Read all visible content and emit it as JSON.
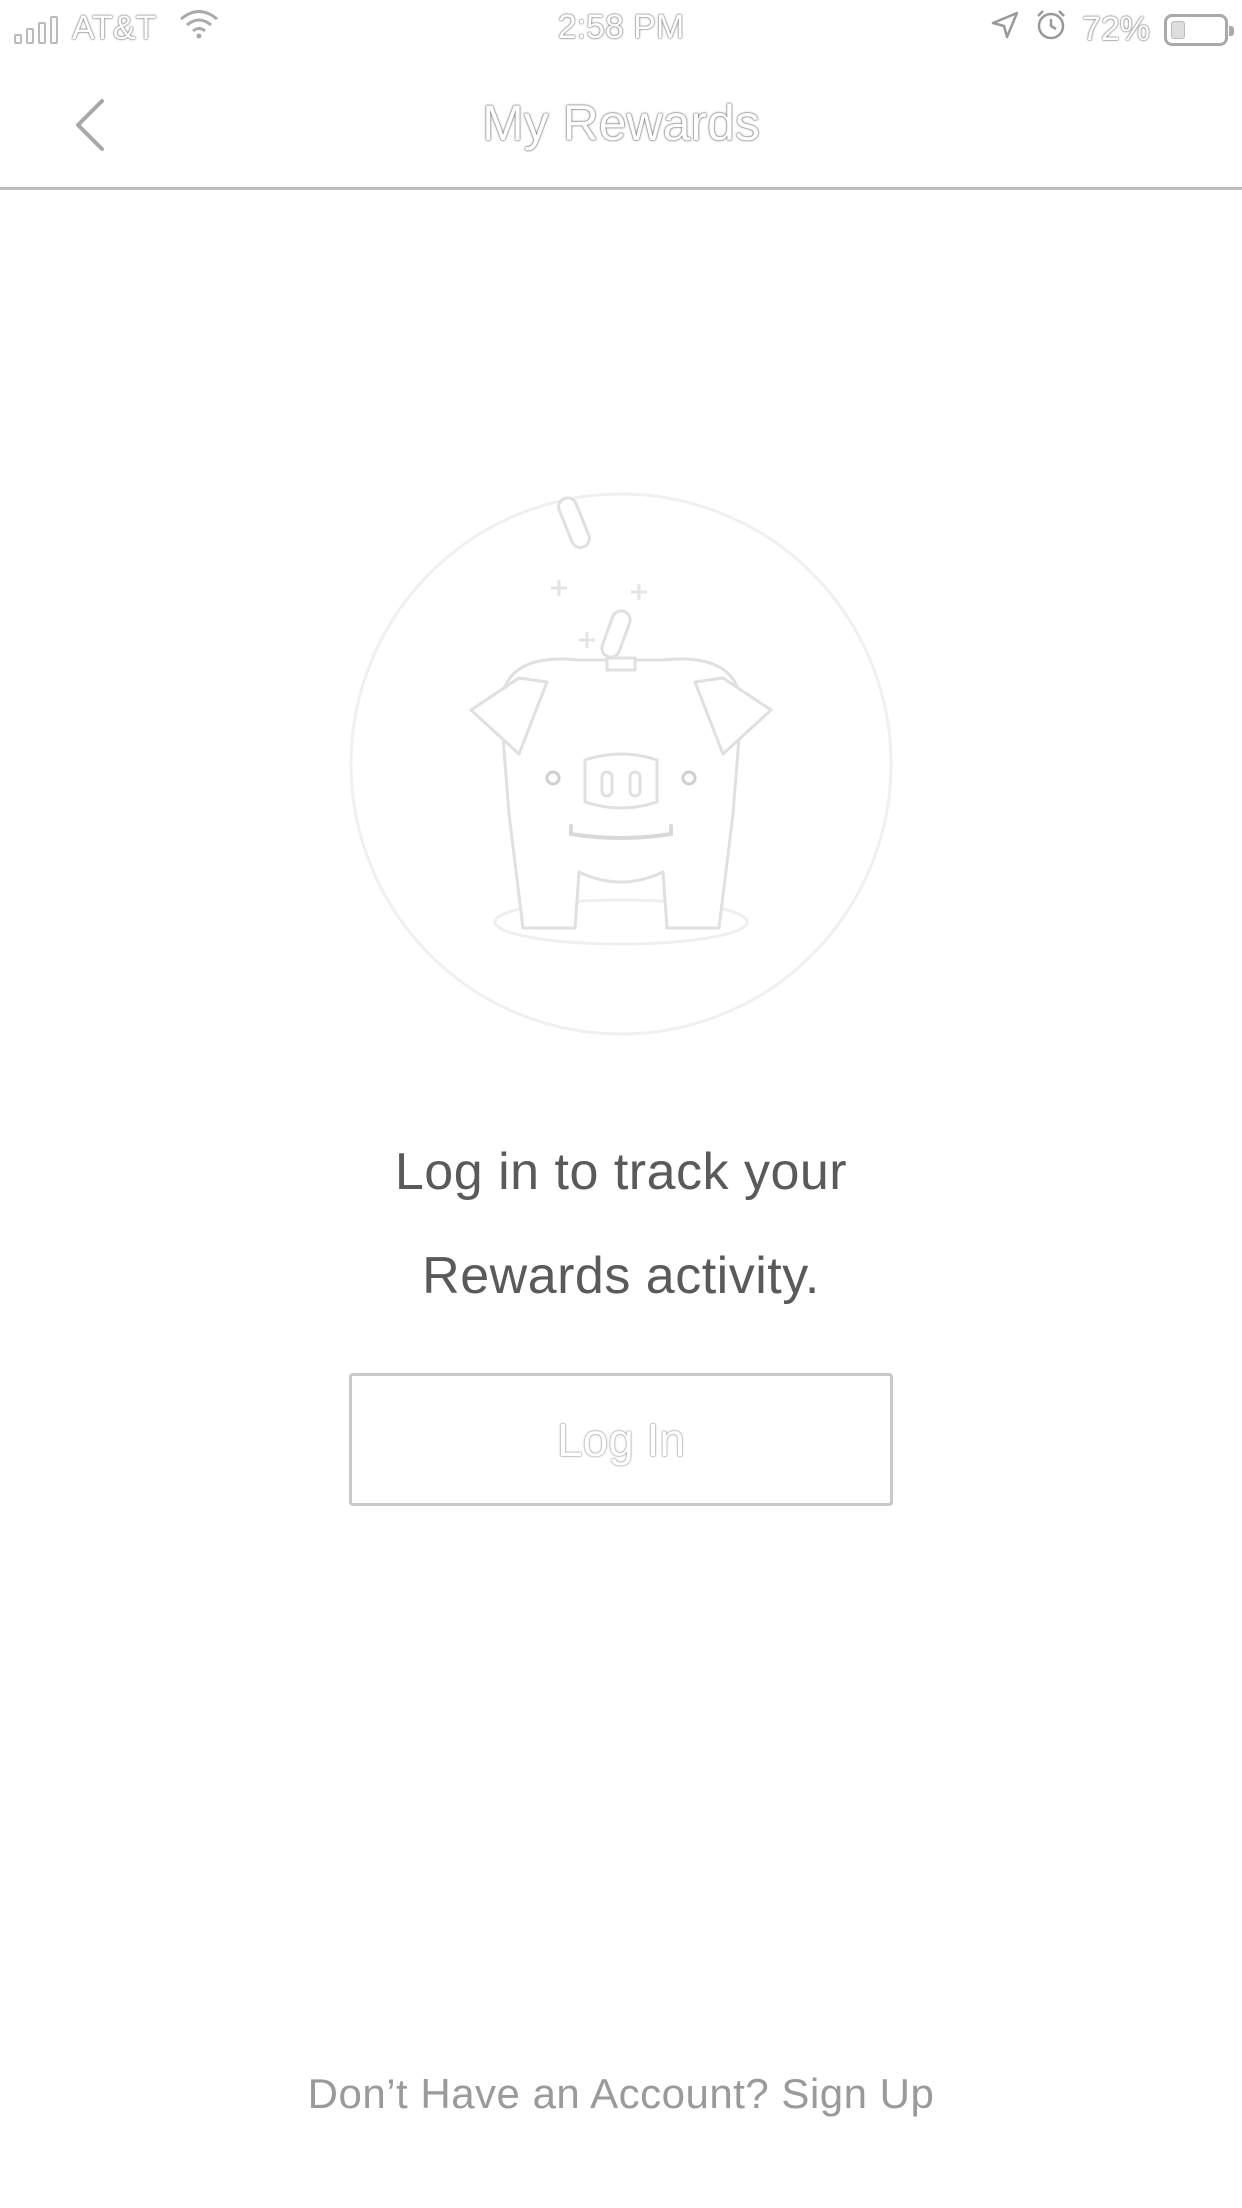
{
  "status_bar": {
    "carrier": "AT&T",
    "time": "2:58 PM",
    "battery_percent": "72%",
    "battery_level": 0.72,
    "signal_bars_filled": 1,
    "signal_bars_total": 4
  },
  "nav": {
    "title": "My Rewards",
    "back_icon": "chevron-left-icon"
  },
  "illustration": {
    "icon": "piggy-bank-icon"
  },
  "message": {
    "line1": "Log in to track your",
    "line2": "Rewards activity."
  },
  "login_button": {
    "label": "Log In"
  },
  "footer": {
    "signup_text": "Don’t Have an Account? Sign Up"
  },
  "colors": {
    "background": "#ffffff",
    "text": "#5a5a5a",
    "muted": "#9a9a9a",
    "border": "#c9c9c9"
  }
}
